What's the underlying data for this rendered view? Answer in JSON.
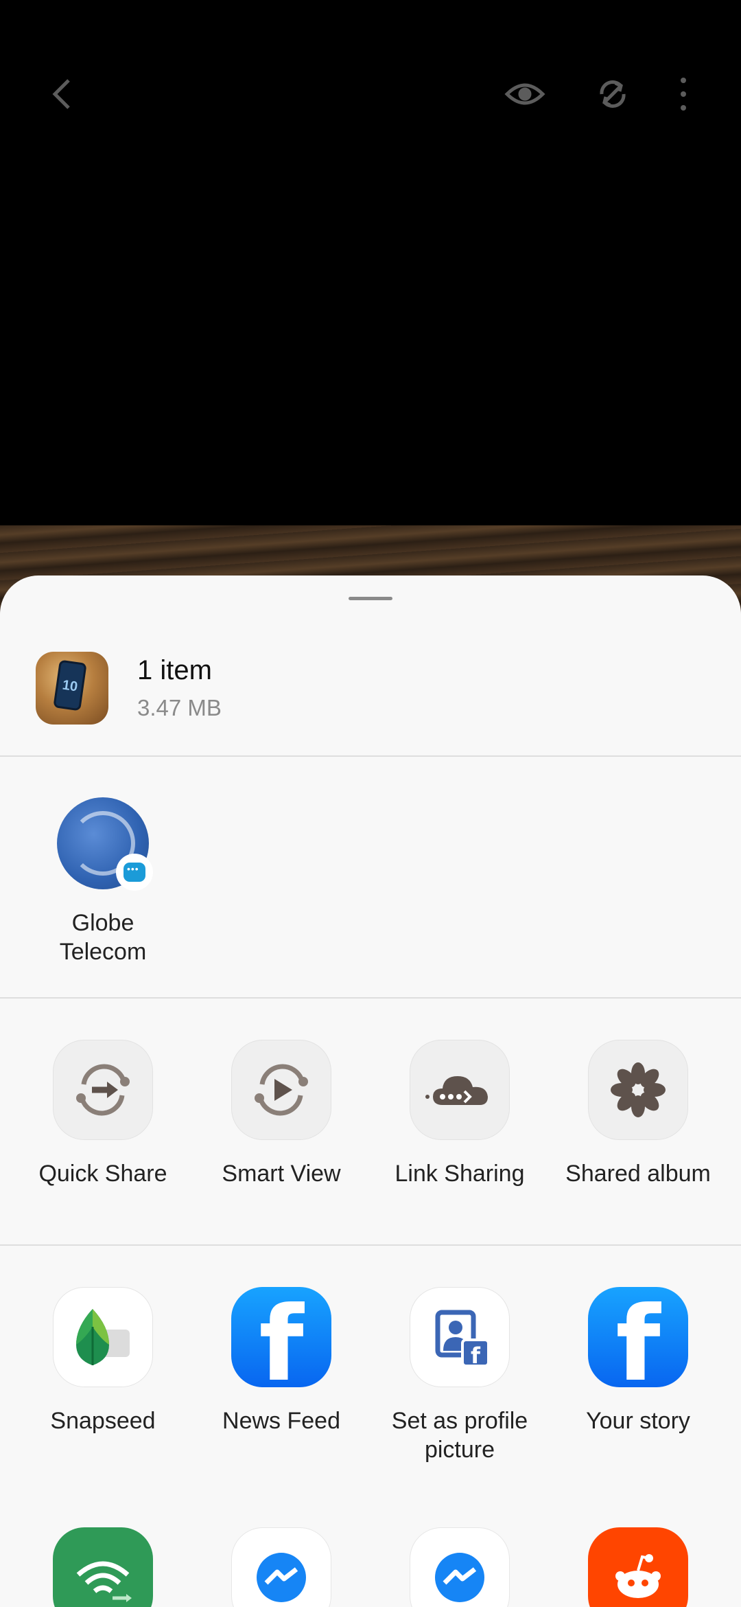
{
  "viewer": {
    "toolbar": {
      "back_icon": "chevron-left-icon",
      "view_icon": "eye-icon",
      "rotate_icon": "auto-rotate-icon",
      "more_icon": "more-vertical-icon"
    }
  },
  "share_sheet": {
    "item": {
      "title": "1 item",
      "size": "3.47 MB",
      "thumbnail_text": "10"
    },
    "direct_share": [
      {
        "label": "Globe Telecom",
        "icon": "globe-telecom-avatar",
        "badge_icon": "messages-badge-icon"
      }
    ],
    "quick_actions": [
      {
        "label": "Quick Share",
        "icon": "quick-share-icon"
      },
      {
        "label": "Smart View",
        "icon": "smart-view-icon"
      },
      {
        "label": "Link Sharing",
        "icon": "link-sharing-cloud-icon"
      },
      {
        "label": "Shared album",
        "icon": "shared-album-flower-icon"
      }
    ],
    "apps": [
      {
        "label": "Snapseed",
        "icon": "snapseed-icon"
      },
      {
        "label": "News Feed",
        "icon": "facebook-icon",
        "glyph": "f"
      },
      {
        "label": "Set as profile picture",
        "icon": "facebook-profile-picture-icon"
      },
      {
        "label": "Your story",
        "icon": "facebook-icon",
        "glyph": "f"
      }
    ],
    "apps_row2": [
      {
        "icon": "wifi-transfer-icon"
      },
      {
        "icon": "messenger-icon"
      },
      {
        "icon": "messenger-icon"
      },
      {
        "icon": "reddit-icon"
      }
    ],
    "colors": {
      "sheet_bg": "#f8f8f8",
      "facebook_blue": "#0866f0",
      "reddit_orange": "#ff4500",
      "globe_blue": "#2f62b1"
    }
  }
}
